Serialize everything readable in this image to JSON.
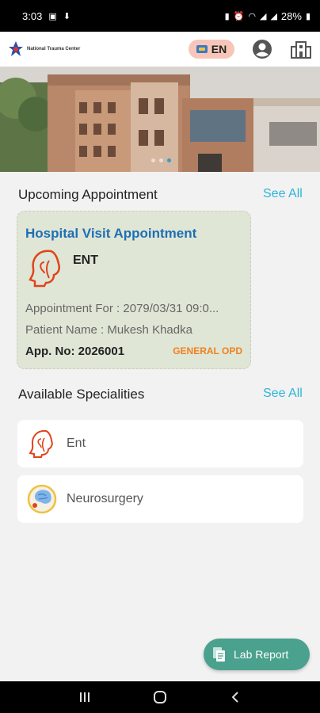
{
  "status_bar": {
    "time": "3:03",
    "battery": "28%"
  },
  "header": {
    "logo_text": "National Trauma Center",
    "language": "EN"
  },
  "icons": {
    "profile": "account-circle-icon",
    "hospital": "hospital-building-icon",
    "ent": "ent-head-icon",
    "neuro": "brain-icon",
    "lab": "document-icon"
  },
  "upcoming": {
    "title": "Upcoming Appointment",
    "see_all": "See All",
    "card": {
      "title": "Hospital Visit Appointment",
      "department": "ENT",
      "appointment_for": "Appointment For : 2079/03/31 09:0...",
      "patient_name": "Patient Name : Mukesh Khadka",
      "app_no": "App. No: 2026001",
      "opd": "GENERAL OPD"
    }
  },
  "specialities": {
    "title": "Available Specialities",
    "see_all": "See All",
    "items": [
      {
        "label": "Ent"
      },
      {
        "label": "Neurosurgery"
      }
    ]
  },
  "lab_report": {
    "label": "Lab Report"
  },
  "colors": {
    "accent": "#2bb6d8",
    "card_bg": "#dfe6d6",
    "title_blue": "#1e6fb3",
    "opd_orange": "#f0801e",
    "fab_green": "#4aa18d"
  }
}
